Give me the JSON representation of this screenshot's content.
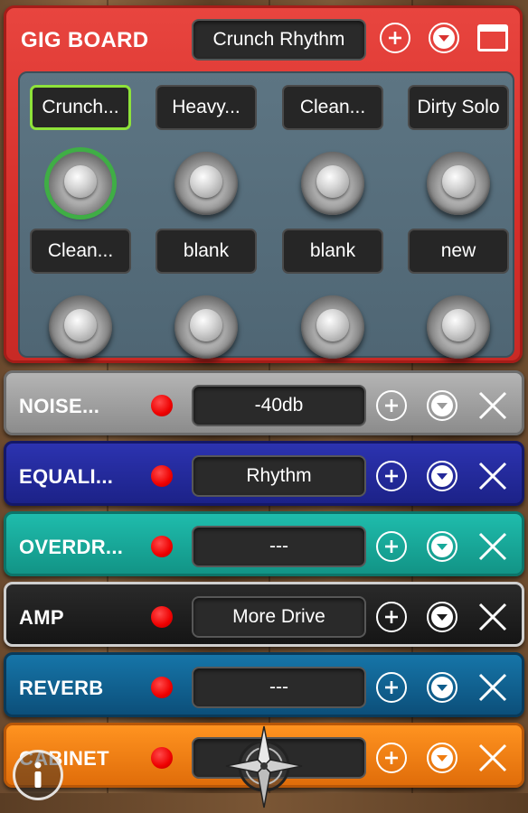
{
  "gig_board": {
    "title": "GIG BOARD",
    "current_preset": "Crunch Rhythm",
    "pedals": [
      {
        "label": "Crunch...",
        "active": true
      },
      {
        "label": "Heavy...",
        "active": false
      },
      {
        "label": "Clean...",
        "active": false
      },
      {
        "label": "Dirty Solo",
        "active": false
      },
      {
        "label": "Clean...",
        "active": false
      },
      {
        "label": "blank",
        "active": false
      },
      {
        "label": "blank",
        "active": false
      },
      {
        "label": "new",
        "active": false
      }
    ]
  },
  "effects": [
    {
      "name": "NOISE...",
      "value": "-40db",
      "color": "#9a9a9a"
    },
    {
      "name": "EQUALI...",
      "value": "Rhythm",
      "color": "#23289a"
    },
    {
      "name": "OVERDR...",
      "value": "---",
      "color": "#17a99a"
    },
    {
      "name": "AMP",
      "value": "More Drive",
      "color": "#1c1c1c"
    },
    {
      "name": "REVERB",
      "value": "---",
      "color": "#0f5d8c"
    },
    {
      "name": "CABINET",
      "value": "",
      "color": "#f07d10"
    }
  ],
  "icons": {
    "add": "plus-circle-icon",
    "move_down": "chevron-down-circle-icon",
    "remove": "close-icon",
    "window": "window-icon",
    "info": "info-icon",
    "navigation": "compass-icon"
  },
  "colors": {
    "gig_board": "#d93330",
    "panel": "#56707e",
    "active_border": "#8ee23a",
    "active_ring": "#3fae45",
    "led": "#ee0000"
  }
}
